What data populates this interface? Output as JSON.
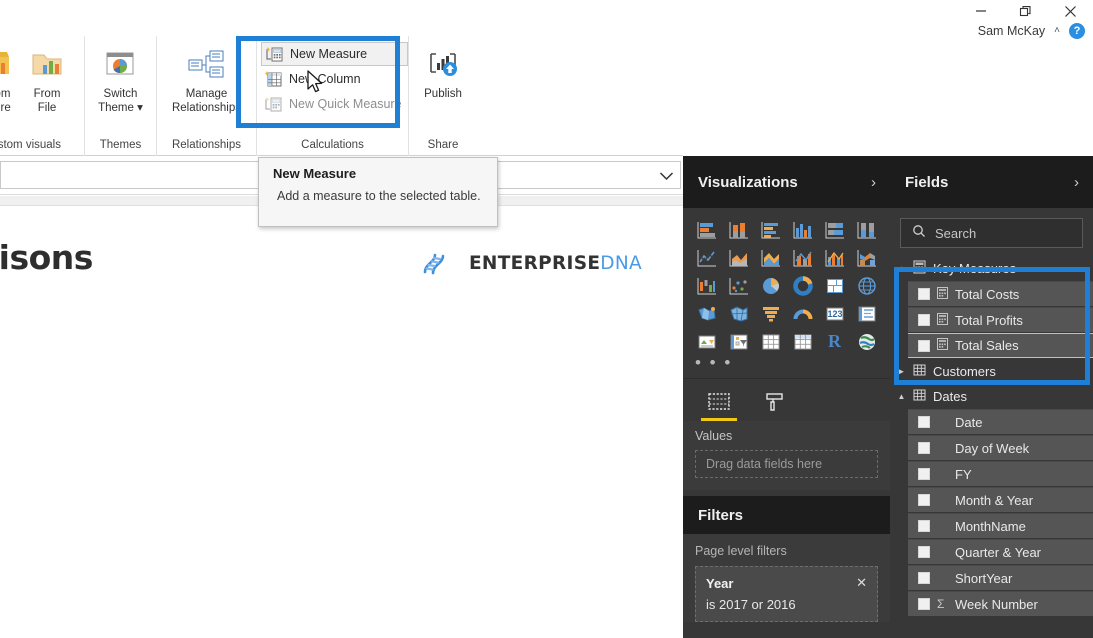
{
  "titlebar": {
    "minimize_label": "minimize-icon",
    "restore_label": "restore-icon",
    "close_label": "close-icon",
    "account_name": "Sam McKay",
    "account_chevron": "˄",
    "help_label": "?"
  },
  "ribbon": {
    "groups": [
      {
        "label": "Custom visuals",
        "buttons": [
          {
            "label": "From\nStore",
            "icon": "store-icon"
          },
          {
            "label": "From\nFile",
            "icon": "folder-icon"
          }
        ]
      },
      {
        "label": "Themes",
        "buttons": [
          {
            "label": "Switch\nTheme ▾",
            "icon": "theme-icon"
          }
        ]
      },
      {
        "label": "Relationships",
        "buttons": [
          {
            "label": "Manage\nRelationships",
            "icon": "relationships-icon"
          }
        ]
      },
      {
        "label": "Calculations",
        "items": [
          {
            "label": "New Measure",
            "state": "hover"
          },
          {
            "label": "New Column",
            "state": "normal"
          },
          {
            "label": "New Quick Measure",
            "state": "dimmed"
          }
        ]
      },
      {
        "label": "Share",
        "buttons": [
          {
            "label": "Publish",
            "icon": "publish-icon"
          }
        ]
      }
    ]
  },
  "tooltip": {
    "title": "New Measure",
    "body": "Add a measure to the selected table."
  },
  "canvas": {
    "report_title": "parisons",
    "brand_primary": "ENTERPRISE",
    "brand_secondary": "DNA"
  },
  "visualizations": {
    "title": "Visualizations",
    "chevron": "›",
    "icons": [
      "stacked-bar-chart-icon",
      "stacked-column-chart-icon",
      "clustered-bar-chart-icon",
      "clustered-column-chart-icon",
      "100-stacked-bar-chart-icon",
      "100-stacked-column-chart-icon",
      "line-chart-icon",
      "area-chart-icon",
      "stacked-area-chart-icon",
      "line-stacked-column-chart-icon",
      "line-clustered-column-chart-icon",
      "ribbon-chart-icon",
      "waterfall-chart-icon",
      "scatter-chart-icon",
      "pie-chart-icon",
      "donut-chart-icon",
      "treemap-icon",
      "map-icon",
      "filled-map-icon",
      "shape-map-icon",
      "funnel-icon",
      "gauge-icon",
      "card-icon",
      "multi-row-card-icon",
      "kpi-icon",
      "slicer-icon",
      "table-icon",
      "matrix-icon",
      "r-script-visual-icon",
      "arcgis-map-icon"
    ],
    "more_dots": "• • •",
    "tabs": [
      "fields-pane-tab-icon",
      "format-pane-tab-icon"
    ],
    "values_label": "Values",
    "values_placeholder": "Drag data fields here"
  },
  "filters": {
    "title": "Filters",
    "page_level_label": "Page level filters",
    "cards": [
      {
        "name": "Year",
        "value": "is 2017 or 2016",
        "close": "✕"
      }
    ]
  },
  "fields": {
    "title": "Fields",
    "chevron": "›",
    "search_placeholder": "Search",
    "search_icon": "search-icon",
    "tree": [
      {
        "name": "Key Measures",
        "type": "measure-table",
        "expanded": true,
        "children": [
          {
            "name": "Total Costs",
            "type": "measure",
            "selected": false
          },
          {
            "name": "Total Profits",
            "type": "measure",
            "selected": false
          },
          {
            "name": "Total Sales",
            "type": "measure",
            "selected": true
          }
        ]
      },
      {
        "name": "Customers",
        "type": "table",
        "expanded": false,
        "children": []
      },
      {
        "name": "Dates",
        "type": "table",
        "expanded": true,
        "children": [
          {
            "name": "Date",
            "type": "column"
          },
          {
            "name": "Day of Week",
            "type": "column"
          },
          {
            "name": "FY",
            "type": "column"
          },
          {
            "name": "Month & Year",
            "type": "column"
          },
          {
            "name": "MonthName",
            "type": "column"
          },
          {
            "name": "Quarter & Year",
            "type": "column"
          },
          {
            "name": "ShortYear",
            "type": "column"
          },
          {
            "name": "Week Number",
            "type": "numeric-column"
          }
        ]
      }
    ]
  },
  "highlights": {
    "color": "#1f7fd4",
    "boxes": [
      {
        "name": "calculations-group-highlight"
      },
      {
        "name": "key-measures-highlight"
      }
    ]
  },
  "colors": {
    "accent_blue": "#1f7fd4",
    "selection_yellow": "#f2c811",
    "panel_dark": "#373737",
    "panel_header_dark": "#1c1c1c"
  }
}
